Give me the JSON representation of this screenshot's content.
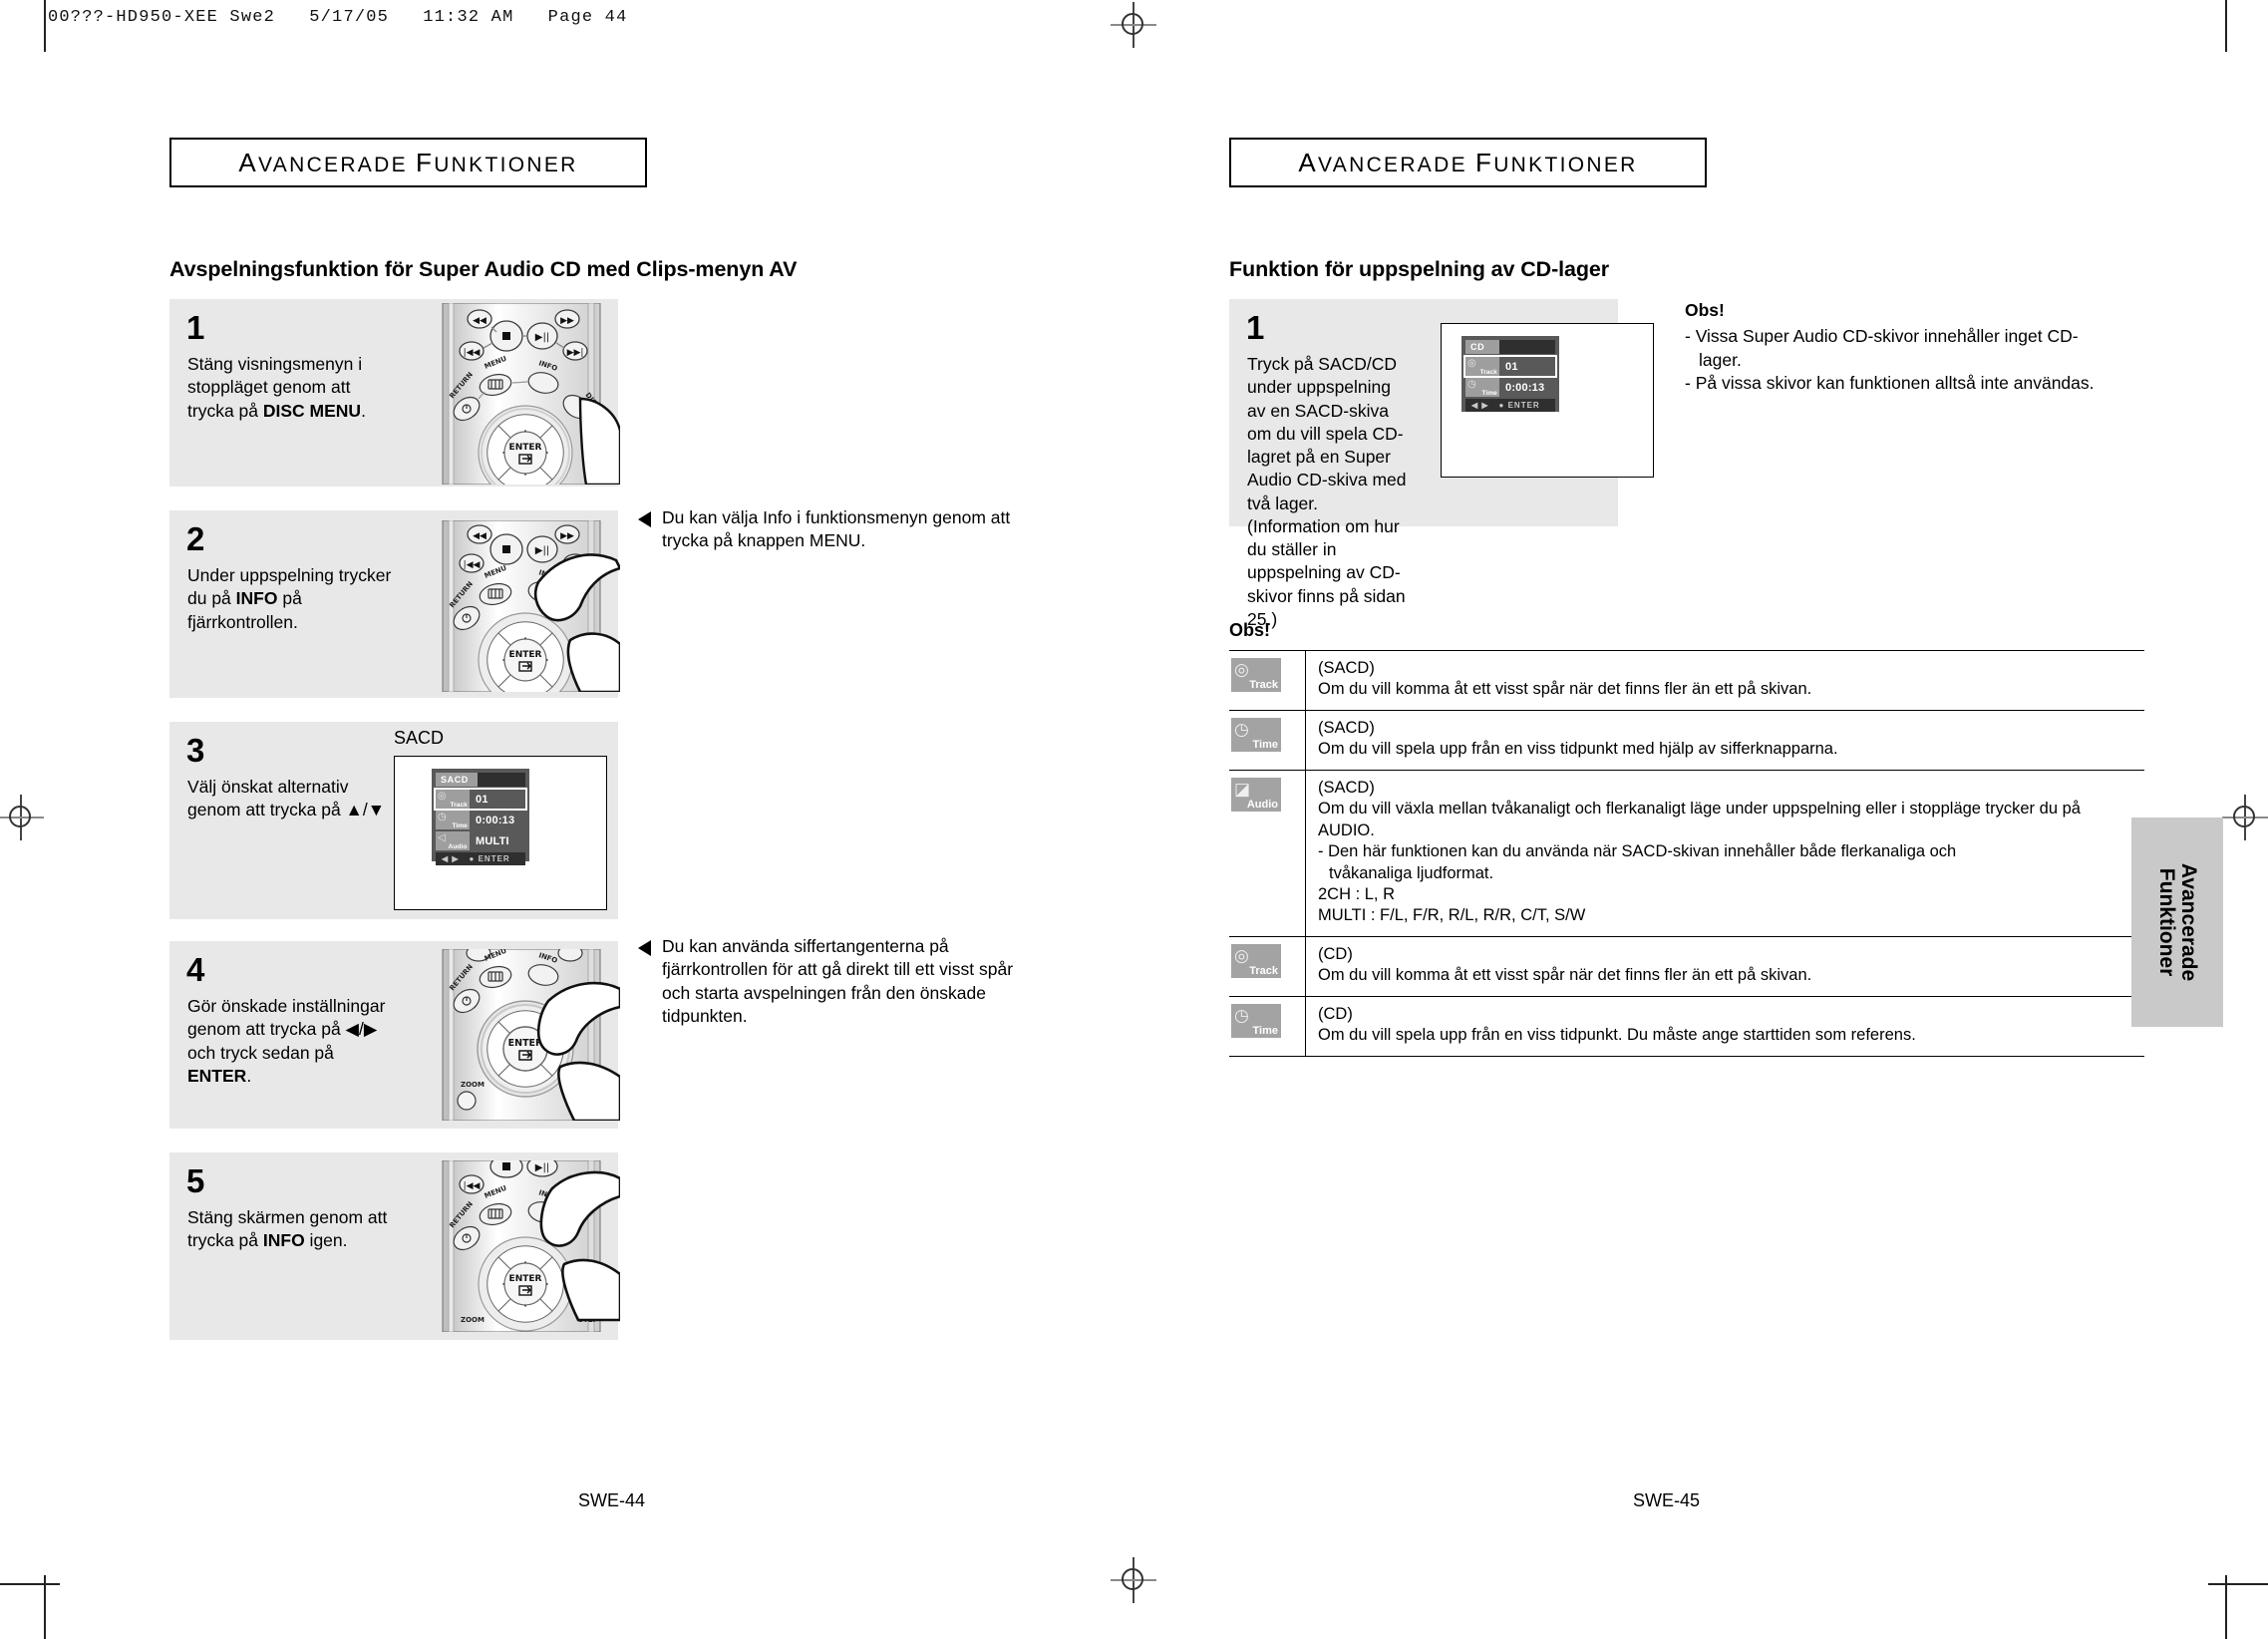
{
  "prepress": {
    "header": "00???-HD950-XEE Swe2   5/17/05   11:32 AM   Page 44"
  },
  "left_page": {
    "section_header": "AVANCERADE FUNKTIONER",
    "topic_title": "Avspelningsfunktion för Super Audio CD med Clips-menyn AV",
    "steps": [
      {
        "num": "1",
        "text_parts": [
          "Stäng visningsmenyn i stoppläget genom att trycka på ",
          "DISC MENU",
          "."
        ]
      },
      {
        "num": "2",
        "text_parts": [
          "Under uppspelning trycker du på ",
          "INFO",
          " på fjärrkontrollen."
        ]
      },
      {
        "num": "3",
        "text_parts": [
          "Välj önskat alternativ genom att trycka på ▲/▼",
          "",
          ""
        ]
      },
      {
        "num": "4",
        "text_parts": [
          "Gör önskade inställningar genom att trycka på ◀/▶ och tryck sedan på ",
          "ENTER",
          "."
        ]
      },
      {
        "num": "5",
        "text_parts": [
          "Stäng skärmen genom att trycka på ",
          "INFO",
          " igen."
        ]
      }
    ],
    "sidenotes": [
      "Du kan välja Info i funktionsmenyn genom att trycka på knappen MENU.",
      "Du kan använda siffertangenterna på fjärrkontrollen för att gå direkt till ett visst spår och starta avspelningen från den önskade tidpunkten."
    ],
    "screen_label": "SACD",
    "sacd_osd": {
      "title": "SACD",
      "rows": [
        {
          "icon": "track-icon",
          "label": "Track",
          "value": "01",
          "selected": true
        },
        {
          "icon": "time-icon",
          "label": "Time",
          "value": "0:00:13",
          "selected": false
        },
        {
          "icon": "audio-icon",
          "label": "Audio",
          "value": "MULTI",
          "selected": false
        }
      ],
      "footer_left": "◀ ▶",
      "footer_right": "● ENTER"
    },
    "page_number": "SWE-44"
  },
  "right_page": {
    "section_header": "AVANCERADE FUNKTIONER",
    "topic_title": "Funktion för uppspelning av CD-lager",
    "step": {
      "num": "1",
      "text": "Tryck på SACD/CD under uppspelning av en SACD-skiva om du vill spela CD-lagret på en Super Audio CD-skiva med två lager. (Information om hur du ställer in uppspelning av CD-skivor finns på sidan 25.)"
    },
    "cd_osd": {
      "title": "CD",
      "rows": [
        {
          "icon": "track-icon",
          "label": "Track",
          "value": "01",
          "selected": true
        },
        {
          "icon": "time-icon",
          "label": "Time",
          "value": "0:00:13",
          "selected": false
        }
      ],
      "footer_left": "◀ ▶",
      "footer_right": "● ENTER"
    },
    "obs_top": {
      "heading": "Obs!",
      "items": [
        "- Vissa Super Audio CD-skivor innehåller inget CD-lager.",
        "- På vissa skivor kan funktionen alltså inte användas."
      ]
    },
    "obs_table_title": "Obs!",
    "obs_table": [
      {
        "icon": "track-icon",
        "icon_label": "Track",
        "lines": [
          {
            "text": "(SACD)",
            "style": "plain"
          },
          {
            "text": "Om du vill komma åt ett visst spår när det finns fler än ett på skivan.",
            "style": "plain"
          }
        ]
      },
      {
        "icon": "time-icon",
        "icon_label": "Time",
        "lines": [
          {
            "text": "(SACD)",
            "style": "plain"
          },
          {
            "text": "Om du vill spela upp från en viss tidpunkt med hjälp av sifferknapparna.",
            "style": "plain"
          }
        ]
      },
      {
        "icon": "audio-icon",
        "icon_label": "Audio",
        "lines": [
          {
            "text": "(SACD)",
            "style": "plain"
          },
          {
            "text": "Om du vill växla mellan tvåkanaligt och flerkanaligt läge under uppspelning eller i stoppläge trycker du på AUDIO.",
            "style": "plain"
          },
          {
            "text": "- Den här funktionen kan du använda när SACD-skivan innehåller både flerkanaliga och",
            "style": "dash"
          },
          {
            "text": "tvåkanaliga ljudformat.",
            "style": "indent"
          },
          {
            "text": "2CH : L, R",
            "style": "plain"
          },
          {
            "text": "MULTI : F/L, F/R, R/L, R/R, C/T, S/W",
            "style": "plain"
          }
        ]
      },
      {
        "icon": "track-icon",
        "icon_label": "Track",
        "lines": [
          {
            "text": "(CD)",
            "style": "plain"
          },
          {
            "text": "Om du vill komma åt ett visst spår när det finns fler än ett på skivan.",
            "style": "plain"
          }
        ]
      },
      {
        "icon": "time-icon",
        "icon_label": "Time",
        "lines": [
          {
            "text": "(CD)",
            "style": "plain"
          },
          {
            "text": "Om du vill spela upp från en viss tidpunkt. Du måste ange starttiden som referens.",
            "style": "plain"
          }
        ]
      }
    ],
    "thumb_tab": "Avancerade\nFunktioner",
    "page_number": "SWE-45"
  },
  "colors": {
    "step_bg": "#e8e8e8",
    "osd_bg": "#595959",
    "badge_bg": "#a3a3a3",
    "thumb_tab_bg": "#c9c9c9"
  }
}
